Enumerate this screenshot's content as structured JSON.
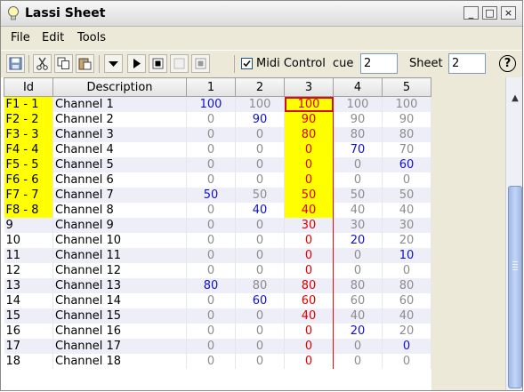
{
  "window": {
    "title": "Lassi Sheet",
    "controls": [
      "_",
      "□",
      "×"
    ]
  },
  "menu": [
    "File",
    "Edit",
    "Tools"
  ],
  "toolbar": {
    "buttons": [
      "save-icon",
      "cut-icon",
      "copy-icon",
      "paste-icon",
      "dropdown-icon",
      "play-icon",
      "stop-icon",
      "record-icon",
      "stop-alt-icon"
    ],
    "midi_label": "Midi Control",
    "midi_checked": true,
    "cue_label": "cue",
    "cue_value": "2",
    "sheet_label": "Sheet",
    "sheet_value": "2",
    "help": "?"
  },
  "table": {
    "headers": [
      "Id",
      "Description",
      "1",
      "2",
      "3",
      "4",
      "5"
    ],
    "rows": [
      {
        "id": "F1 - 1",
        "desc": "Channel 1",
        "v": [
          "100",
          "100",
          "100",
          "100",
          "100"
        ],
        "c": [
          "b",
          "g",
          "r",
          "g",
          "g"
        ]
      },
      {
        "id": "F2 - 2",
        "desc": "Channel 2",
        "v": [
          "0",
          "90",
          "90",
          "90",
          "90"
        ],
        "c": [
          "g",
          "b",
          "r",
          "g",
          "g"
        ]
      },
      {
        "id": "F3 - 3",
        "desc": "Channel 3",
        "v": [
          "0",
          "0",
          "80",
          "80",
          "80"
        ],
        "c": [
          "g",
          "g",
          "r",
          "g",
          "g"
        ]
      },
      {
        "id": "F4 - 4",
        "desc": "Channel 4",
        "v": [
          "0",
          "0",
          "0",
          "70",
          "70"
        ],
        "c": [
          "g",
          "g",
          "r",
          "b",
          "g"
        ]
      },
      {
        "id": "F5 - 5",
        "desc": "Channel 5",
        "v": [
          "0",
          "0",
          "0",
          "0",
          "60"
        ],
        "c": [
          "g",
          "g",
          "r",
          "g",
          "b"
        ]
      },
      {
        "id": "F6 - 6",
        "desc": "Channel 6",
        "v": [
          "0",
          "0",
          "0",
          "0",
          "0"
        ],
        "c": [
          "g",
          "g",
          "r",
          "g",
          "g"
        ]
      },
      {
        "id": "F7 - 7",
        "desc": "Channel 7",
        "v": [
          "50",
          "50",
          "50",
          "50",
          "50"
        ],
        "c": [
          "b",
          "g",
          "r",
          "g",
          "g"
        ]
      },
      {
        "id": "F8 - 8",
        "desc": "Channel 8",
        "v": [
          "0",
          "40",
          "40",
          "40",
          "40"
        ],
        "c": [
          "g",
          "b",
          "r",
          "g",
          "g"
        ]
      },
      {
        "id": "9",
        "desc": "Channel 9",
        "v": [
          "0",
          "0",
          "30",
          "30",
          "30"
        ],
        "c": [
          "g",
          "g",
          "r",
          "g",
          "g"
        ]
      },
      {
        "id": "10",
        "desc": "Channel 10",
        "v": [
          "0",
          "0",
          "0",
          "20",
          "20"
        ],
        "c": [
          "g",
          "g",
          "r",
          "b",
          "g"
        ]
      },
      {
        "id": "11",
        "desc": "Channel 11",
        "v": [
          "0",
          "0",
          "0",
          "0",
          "10"
        ],
        "c": [
          "g",
          "g",
          "r",
          "g",
          "b"
        ]
      },
      {
        "id": "12",
        "desc": "Channel 12",
        "v": [
          "0",
          "0",
          "0",
          "0",
          "0"
        ],
        "c": [
          "g",
          "g",
          "r",
          "g",
          "g"
        ]
      },
      {
        "id": "13",
        "desc": "Channel 13",
        "v": [
          "80",
          "80",
          "80",
          "80",
          "80"
        ],
        "c": [
          "b",
          "g",
          "r",
          "g",
          "g"
        ]
      },
      {
        "id": "14",
        "desc": "Channel 14",
        "v": [
          "0",
          "60",
          "60",
          "60",
          "60"
        ],
        "c": [
          "g",
          "b",
          "r",
          "g",
          "g"
        ]
      },
      {
        "id": "15",
        "desc": "Channel 15",
        "v": [
          "0",
          "0",
          "40",
          "40",
          "40"
        ],
        "c": [
          "g",
          "g",
          "r",
          "g",
          "g"
        ]
      },
      {
        "id": "16",
        "desc": "Channel 16",
        "v": [
          "0",
          "0",
          "0",
          "20",
          "20"
        ],
        "c": [
          "g",
          "g",
          "r",
          "b",
          "g"
        ]
      },
      {
        "id": "17",
        "desc": "Channel 17",
        "v": [
          "0",
          "0",
          "0",
          "0",
          "0"
        ],
        "c": [
          "g",
          "g",
          "r",
          "g",
          "b"
        ]
      },
      {
        "id": "18",
        "desc": "Channel 18",
        "v": [
          "0",
          "0",
          "0",
          "0",
          "0"
        ],
        "c": [
          "g",
          "g",
          "r",
          "g",
          "g"
        ]
      }
    ],
    "highlighted_id_rows": 8,
    "selected_column": "3",
    "selected_row": 1
  },
  "colors": {
    "highlight": "#ffff00",
    "value_blue": "#1010d0",
    "value_grey": "#8c8c8c",
    "value_red": "#e00000",
    "column_border": "#d01010"
  }
}
